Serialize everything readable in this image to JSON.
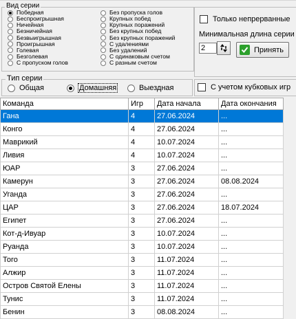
{
  "series_kind": {
    "label": "Вид серии",
    "col1": [
      {
        "label": "Победная",
        "selected": true
      },
      {
        "label": "Беспроигрышная",
        "selected": false
      },
      {
        "label": "Ничейная",
        "selected": false
      },
      {
        "label": "Безничейная",
        "selected": false
      },
      {
        "label": "Безвыигрышная",
        "selected": false
      },
      {
        "label": "Проигрышная",
        "selected": false
      },
      {
        "label": "Голевая",
        "selected": false
      },
      {
        "label": "Безголевая",
        "selected": false
      },
      {
        "label": "С пропуском голов",
        "selected": false
      }
    ],
    "col2": [
      {
        "label": "Без пропуска голов",
        "selected": false
      },
      {
        "label": "Крупных побед",
        "selected": false
      },
      {
        "label": "Крупных поражений",
        "selected": false
      },
      {
        "label": "Без крупных побед",
        "selected": false
      },
      {
        "label": "Без крупных поражений",
        "selected": false
      },
      {
        "label": "С удалениями",
        "selected": false
      },
      {
        "label": "Без удалений",
        "selected": false
      },
      {
        "label": "С одинаковым счетом",
        "selected": false
      },
      {
        "label": "С разным счетом",
        "selected": false
      }
    ]
  },
  "only_continuous": {
    "label": "Только непрерванные",
    "checked": false
  },
  "min_length": {
    "label": "Минимальная длина серии",
    "value": "2"
  },
  "apply_button": {
    "label": "Принять"
  },
  "series_type": {
    "label": "Тип серии",
    "options": [
      {
        "label": "Общая",
        "selected": false
      },
      {
        "label": "Домашняя",
        "selected": true
      },
      {
        "label": "Выездная",
        "selected": false
      }
    ]
  },
  "cup_games": {
    "label": "С учетом кубковых игр",
    "checked": false
  },
  "table": {
    "columns": [
      "Команда",
      "Игр",
      "Дата начала",
      "Дата окончания"
    ],
    "rows": [
      [
        "Гана",
        "4",
        "27.06.2024",
        "..."
      ],
      [
        "Конго",
        "4",
        "27.06.2024",
        "..."
      ],
      [
        "Маврикий",
        "4",
        "10.07.2024",
        "..."
      ],
      [
        "Ливия",
        "4",
        "10.07.2024",
        "..."
      ],
      [
        "ЮАР",
        "3",
        "27.06.2024",
        "..."
      ],
      [
        "Камерун",
        "3",
        "27.06.2024",
        "08.08.2024"
      ],
      [
        "Уганда",
        "3",
        "27.06.2024",
        "..."
      ],
      [
        "ЦАР",
        "3",
        "27.06.2024",
        "18.07.2024"
      ],
      [
        "Египет",
        "3",
        "27.06.2024",
        "..."
      ],
      [
        "Кот-д-Ивуар",
        "3",
        "10.07.2024",
        "..."
      ],
      [
        "Руанда",
        "3",
        "10.07.2024",
        "..."
      ],
      [
        "Того",
        "3",
        "11.07.2024",
        "..."
      ],
      [
        "Алжир",
        "3",
        "11.07.2024",
        "..."
      ],
      [
        "Остров Святой Елены",
        "3",
        "11.07.2024",
        "..."
      ],
      [
        "Тунис",
        "3",
        "11.07.2024",
        "..."
      ],
      [
        "Бенин",
        "3",
        "08.08.2024",
        "..."
      ]
    ],
    "selected_row": 0
  }
}
